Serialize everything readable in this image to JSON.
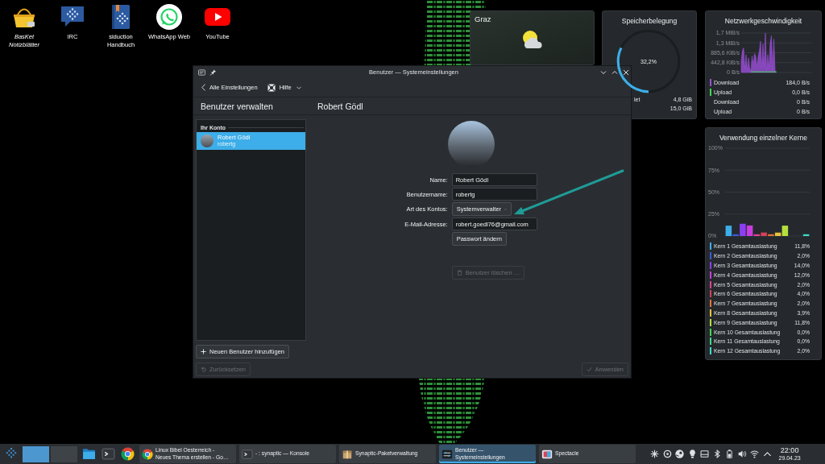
{
  "desktop_icons": [
    {
      "label": "BasKet Notizblätter",
      "kind": "basket",
      "is_link": true
    },
    {
      "label": "IRC",
      "kind": "chat",
      "is_link": false
    },
    {
      "label": "siduction Handbuch",
      "kind": "book",
      "is_link": false
    },
    {
      "label": "WhatsApp Web",
      "kind": "phone_bubble",
      "is_link": false
    },
    {
      "label": "YouTube",
      "kind": "play",
      "is_link": false
    }
  ],
  "widgets": {
    "weather": {
      "location": "Graz"
    },
    "memory": {
      "title": "Speicherbelegung",
      "level": 0.322,
      "reading": "32,2%",
      "rows": [
        {
          "label": "let",
          "value": "4,8 GiB"
        },
        {
          "value": "15,0 GiB"
        }
      ]
    },
    "network": {
      "title": "Netzwerkgeschwindigkeit",
      "axis_labels": [
        "1,7 MiB/s",
        "1,3 MiB/s",
        "885,6 KiB/s",
        "442,8 KiB/s",
        "0 B/s"
      ],
      "legend": [
        {
          "label": "Download",
          "value": "184,0 B/s",
          "color": "#9b4fd8"
        },
        {
          "label": "Upload",
          "value": "0,0 B/s",
          "color": "#3dd94f"
        }
      ],
      "totals": [
        {
          "label": "Download",
          "value": "0 B/s"
        },
        {
          "label": "Upload",
          "value": "0 B/s"
        }
      ]
    },
    "cores": {
      "title": "Verwendung einzelner Kerne",
      "chart_data": {
        "type": "bar",
        "grid": true,
        "ylim": [
          0,
          100
        ],
        "yticks": [
          {
            "value": 100,
            "label": "100%"
          },
          {
            "value": 75,
            "label": "75%"
          },
          {
            "value": 50,
            "label": "50%"
          },
          {
            "value": 25,
            "label": "25%"
          },
          {
            "value": 0,
            "label": "0%"
          }
        ],
        "series": [
          {
            "name": "Kern 1 Gesamtauslastung",
            "color": "#3daee9",
            "values": [
              11.8
            ]
          },
          {
            "name": "Kern 2 Gesamtauslastung",
            "color": "#3b5bdb",
            "values": [
              2.0
            ]
          },
          {
            "name": "Kern 3 Gesamtauslastung",
            "color": "#8a3ff0",
            "values": [
              14.0
            ]
          },
          {
            "name": "Kern 4 Gesamtauslastung",
            "color": "#c83de0",
            "values": [
              12.0
            ]
          },
          {
            "name": "Kern 5 Gesamtauslastung",
            "color": "#e0409a",
            "values": [
              2.0
            ]
          },
          {
            "name": "Kern 6 Gesamtauslastung",
            "color": "#d9405a",
            "values": [
              4.0
            ]
          },
          {
            "name": "Kern 7 Gesamtauslastung",
            "color": "#e8723a",
            "values": [
              2.0
            ]
          },
          {
            "name": "Kern 8 Gesamtauslastung",
            "color": "#e8c23a",
            "values": [
              3.9
            ]
          },
          {
            "name": "Kern 9 Gesamtauslastung",
            "color": "#b5e03d",
            "values": [
              11.8
            ]
          },
          {
            "name": "Kern 10 Gesamtauslastung",
            "color": "#3dd94f",
            "values": [
              0.0
            ]
          },
          {
            "name": "Kern 11 Gesamtauslastung",
            "color": "#3ddc8a",
            "values": [
              0.0
            ]
          },
          {
            "name": "Kern 12 Gesamtauslastung",
            "color": "#3ddcc8",
            "values": [
              2.0
            ]
          }
        ]
      },
      "legend_values": [
        "11,8%",
        "2,0%",
        "14,0%",
        "12,0%",
        "2,0%",
        "4,0%",
        "2,0%",
        "3,9%",
        "11,8%",
        "0,0%",
        "0,0%",
        "2,0%"
      ]
    }
  },
  "window": {
    "title": "Benutzer — Systemeinstellungen",
    "toolbar": {
      "back": "Alle Einstellungen",
      "help": "Hilfe"
    },
    "sidebar": {
      "title": "Benutzer verwalten",
      "section": "Ihr Konto",
      "users": [
        {
          "name": "Robert Gödl",
          "login": "robertg",
          "selected": true
        }
      ],
      "add_button": "Neuen Benutzer hinzufügen"
    },
    "page": {
      "title": "Robert Gödl",
      "fields": [
        {
          "kind": "text",
          "label": "Name:",
          "value": "Robert Gödl"
        },
        {
          "kind": "text",
          "label": "Benutzername:",
          "value": "robertg"
        },
        {
          "kind": "dropdown",
          "label": "Art des Kontos:",
          "value": "Systemverwalter"
        },
        {
          "kind": "text",
          "label": "E-Mail-Adresse:",
          "value": "robert.goedl76@gmail.com"
        }
      ],
      "password_button": "Passwort ändern",
      "delete_button": {
        "label": "Benutzer löschen …",
        "disabled": true
      }
    },
    "footer": {
      "reset": {
        "label": "Zurücksetzen",
        "disabled": true
      },
      "apply": {
        "label": "Anwenden",
        "disabled": true
      }
    }
  },
  "taskbar": {
    "pager": [
      {
        "selected": true
      },
      {
        "selected": false
      }
    ],
    "pinned": [
      {
        "kind": "folder"
      },
      {
        "kind": "terminal"
      },
      {
        "kind": "browser"
      }
    ],
    "tasks": [
      {
        "kind": "browser",
        "label": "Linux Bibel Oesterreich -\nNeues Thema erstellen - Go…",
        "selected": false
      },
      {
        "kind": "terminal",
        "label": "- : synaptic — Konsole",
        "selected": false
      },
      {
        "kind": "package",
        "label": "Synaptic-Paketverwaltung",
        "selected": false
      },
      {
        "kind": "settings",
        "label": "Benutzer —\nSystemeinstellungen",
        "selected": true
      },
      {
        "kind": "screenshot",
        "label": "Spectacle",
        "selected": false
      }
    ],
    "tray": [
      {
        "kind": "asterisk"
      },
      {
        "kind": "ring"
      },
      {
        "kind": "disc"
      },
      {
        "kind": "lightbulb"
      },
      {
        "kind": "drive"
      },
      {
        "kind": "bluetooth"
      },
      {
        "kind": "battery"
      },
      {
        "kind": "speaker"
      },
      {
        "kind": "wifi"
      },
      {
        "kind": "caret_up"
      }
    ],
    "clock": {
      "time": "22:00",
      "date": "29.04.23"
    }
  }
}
